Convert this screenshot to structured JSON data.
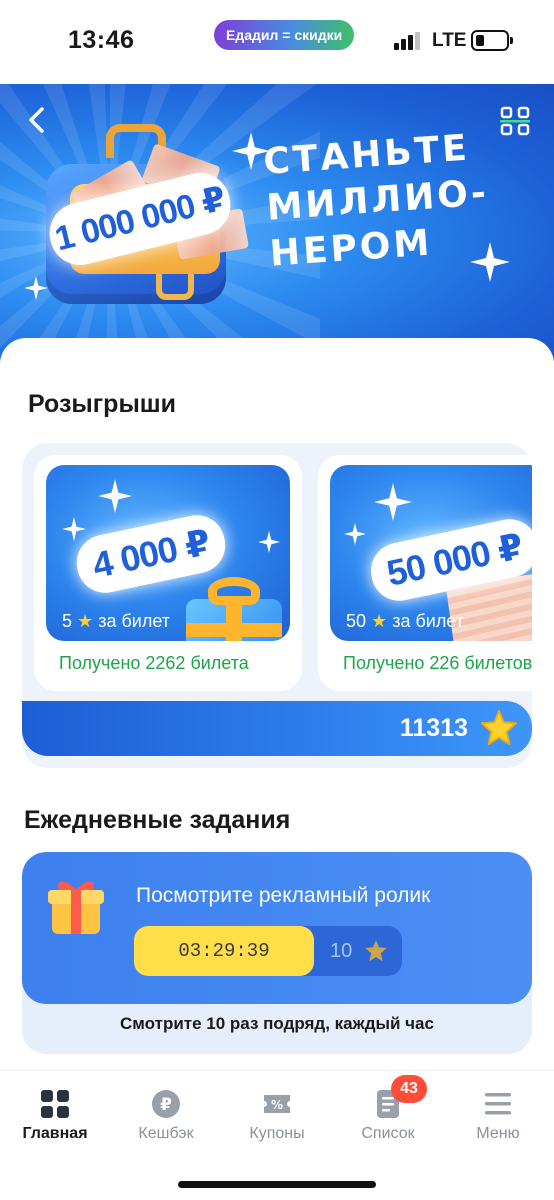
{
  "status_bar": {
    "time": "13:46",
    "promo_pill": "Едадил = скидки",
    "network": "LTE"
  },
  "banner": {
    "prize_amount": "1 000 000 ₽",
    "headline_lines": [
      "СТАНЬТЕ",
      "МИЛЛИО-",
      "НЕРОМ"
    ]
  },
  "raffles": {
    "title": "Розыгрыши",
    "items": [
      {
        "amount": "4 000 ₽",
        "ticket_cost": "5",
        "ticket_suffix": "за билет",
        "received": "Получено 2262 билета"
      },
      {
        "amount": "50 000 ₽",
        "ticket_cost": "50",
        "ticket_suffix": "за билет",
        "received": "Получено 226 билетов"
      }
    ],
    "stars_balance": "11313"
  },
  "daily_tasks": {
    "title": "Ежедневные задания",
    "task": {
      "title": "Посмотрите рекламный ролик",
      "timer": "03:29:39",
      "reward": "10",
      "note": "Смотрите 10 раз подряд, каждый час"
    }
  },
  "bottom_nav": {
    "items": [
      {
        "label": "Главная",
        "icon": "home-grid-icon",
        "active": true
      },
      {
        "label": "Кешбэк",
        "icon": "ruble-coin-icon"
      },
      {
        "label": "Купоны",
        "icon": "coupon-percent-icon"
      },
      {
        "label": "Список",
        "icon": "list-doc-icon",
        "badge": "43"
      },
      {
        "label": "Меню",
        "icon": "hamburger-menu-icon"
      }
    ]
  },
  "colors": {
    "brand_blue": "#2d86ee",
    "accent_yellow": "#ffde4a",
    "success_green": "#1fa34a",
    "badge_red": "#ff4d3a"
  }
}
